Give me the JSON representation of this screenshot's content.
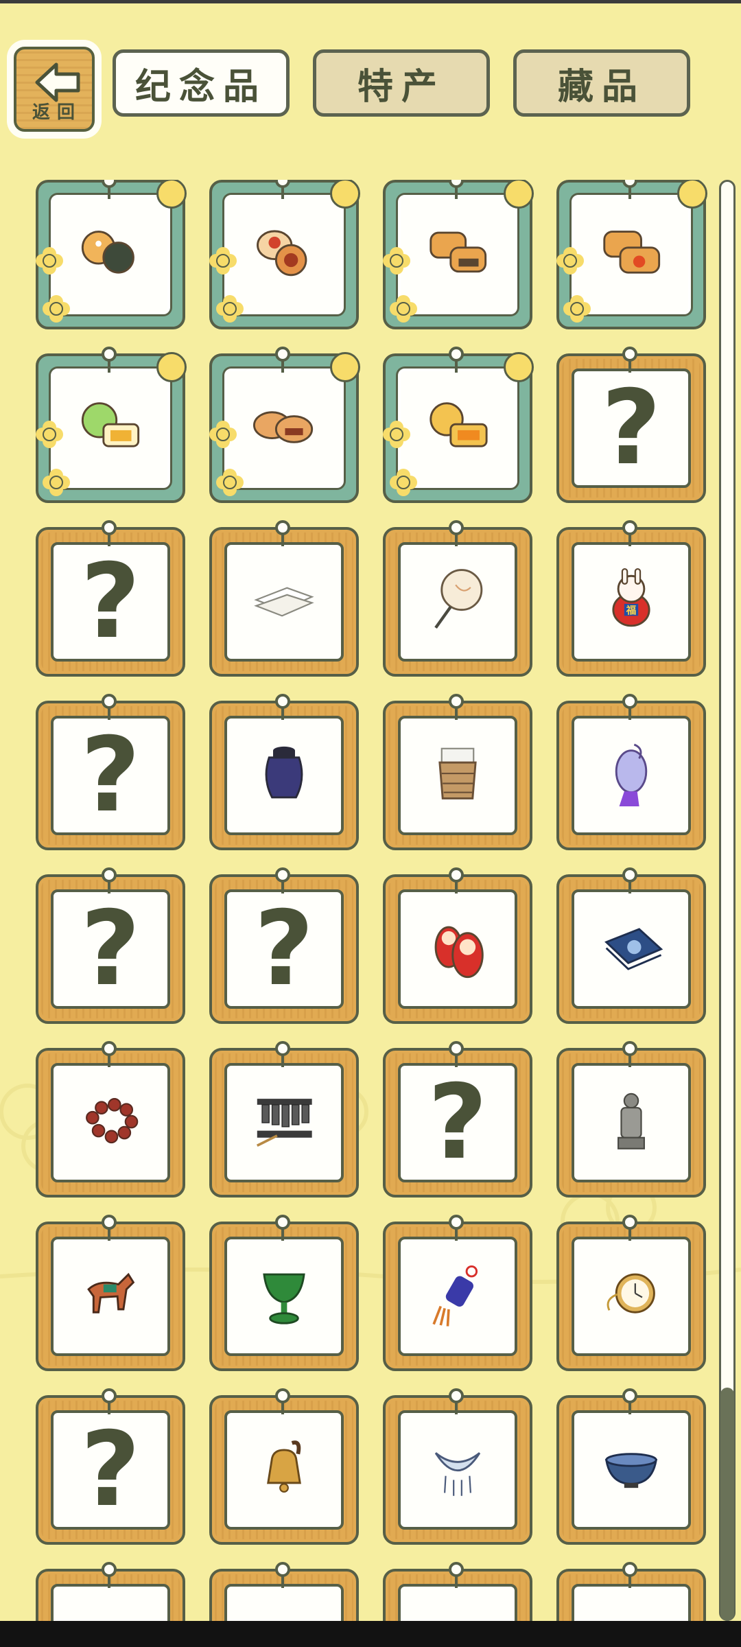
{
  "nav": {
    "back_label": "返回",
    "tabs": [
      {
        "label": "纪念品",
        "active": true
      },
      {
        "label": "特产",
        "active": false
      },
      {
        "label": "藏品",
        "active": false
      }
    ]
  },
  "colors": {
    "background": "#f6eea0",
    "gold_frame": "#e1aa52",
    "green_frame": "#7fb59e",
    "outline": "#565f47"
  },
  "items": [
    {
      "icon": "mooncake-pair-icon",
      "frame": "green"
    },
    {
      "icon": "red-mooncake-pair-icon",
      "frame": "green"
    },
    {
      "icon": "cantonese-mooncake-icon",
      "frame": "green"
    },
    {
      "icon": "egg-yolk-mooncake-icon",
      "frame": "green"
    },
    {
      "icon": "green-mooncake-icon",
      "frame": "green"
    },
    {
      "icon": "baked-mooncake-icon",
      "frame": "green"
    },
    {
      "icon": "flower-mooncake-icon",
      "frame": "green"
    },
    {
      "icon": "unknown-item-icon",
      "frame": "gold",
      "locked": true
    },
    {
      "icon": "unknown-item-icon",
      "frame": "gold",
      "locked": true
    },
    {
      "icon": "folded-cloth-icon",
      "frame": "gold"
    },
    {
      "icon": "round-fan-icon",
      "frame": "gold"
    },
    {
      "icon": "lucky-rabbit-figure-icon",
      "frame": "gold",
      "text": "福"
    },
    {
      "icon": "unknown-item-icon",
      "frame": "gold",
      "locked": true
    },
    {
      "icon": "clay-jar-icon",
      "frame": "gold"
    },
    {
      "icon": "woven-cup-icon",
      "frame": "gold"
    },
    {
      "icon": "sachet-pouch-icon",
      "frame": "gold"
    },
    {
      "icon": "unknown-item-icon",
      "frame": "gold",
      "locked": true
    },
    {
      "icon": "unknown-item-icon",
      "frame": "gold",
      "locked": true
    },
    {
      "icon": "nesting-dolls-icon",
      "frame": "gold"
    },
    {
      "icon": "blue-handkerchief-icon",
      "frame": "gold"
    },
    {
      "icon": "prayer-beads-icon",
      "frame": "gold"
    },
    {
      "icon": "bronze-chime-icon",
      "frame": "gold"
    },
    {
      "icon": "unknown-item-icon",
      "frame": "gold",
      "locked": true
    },
    {
      "icon": "terracotta-warrior-icon",
      "frame": "gold"
    },
    {
      "icon": "tang-horse-icon",
      "frame": "gold"
    },
    {
      "icon": "jade-cup-icon",
      "frame": "gold"
    },
    {
      "icon": "tassel-knot-icon",
      "frame": "gold"
    },
    {
      "icon": "pocket-watch-icon",
      "frame": "gold"
    },
    {
      "icon": "unknown-item-icon",
      "frame": "gold",
      "locked": true
    },
    {
      "icon": "brass-bell-icon",
      "frame": "gold"
    },
    {
      "icon": "silver-necklace-icon",
      "frame": "gold"
    },
    {
      "icon": "tea-bowl-icon",
      "frame": "gold"
    },
    {
      "icon": "partial-item-icon",
      "frame": "gold"
    },
    {
      "icon": "partial-item-icon",
      "frame": "gold"
    },
    {
      "icon": "partial-item-icon",
      "frame": "gold"
    },
    {
      "icon": "partial-item-icon",
      "frame": "gold"
    }
  ],
  "locked_symbol": "?"
}
